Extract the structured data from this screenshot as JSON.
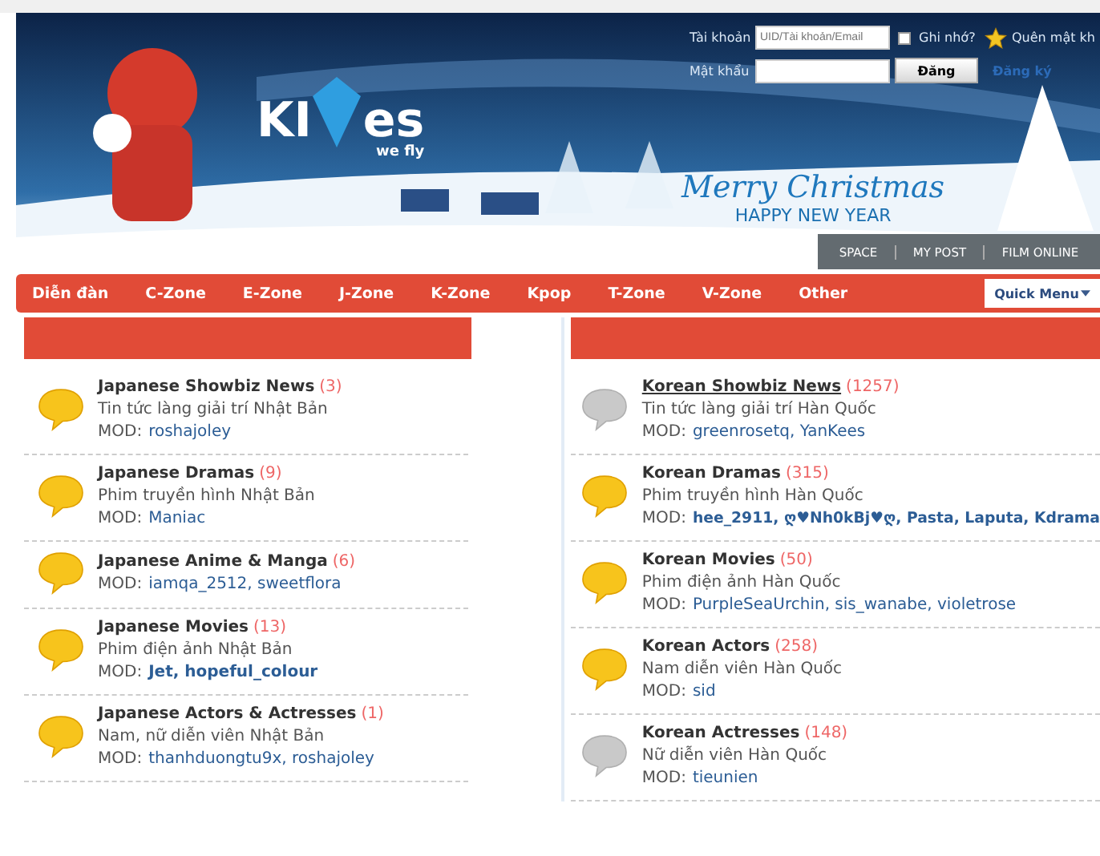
{
  "banner": {
    "logo_left": "KI",
    "logo_right": "es",
    "tagline": "we fly",
    "greeting": "Merry Christmas",
    "greeting_sub": "HAPPY NEW YEAR"
  },
  "login": {
    "account_label": "Tài khoản",
    "account_placeholder": "UID/Tài khoản/Email",
    "remember_label": "Ghi nhớ?",
    "remember_checked": false,
    "forgot_link": "Quên mật kh",
    "password_label": "Mật khẩu",
    "submit": "Đăng",
    "register_link": "Đăng ký"
  },
  "sub_tabs": [
    "SPACE",
    "MY POST",
    "FILM ONLINE"
  ],
  "nav": {
    "items": [
      "Diễn đàn",
      "C-Zone",
      "E-Zone",
      "J-Zone",
      "K-Zone",
      "Kpop",
      "T-Zone",
      "V-Zone",
      "Other"
    ],
    "quick_menu": "Quick Menu"
  },
  "columns": [
    {
      "forums": [
        {
          "title": "Japanese Showbiz News",
          "count": "(3)",
          "description": "Tin tức làng giải trí Nhật Bản",
          "mod_label": "MOD:",
          "mods": "roshajoley",
          "mods_bold": false,
          "has_new": true,
          "hovered": false
        },
        {
          "title": "Japanese Dramas",
          "count": "(9)",
          "description": "Phim truyền hình Nhật Bản",
          "mod_label": "MOD:",
          "mods": "Maniac",
          "mods_bold": false,
          "has_new": true,
          "hovered": false
        },
        {
          "title": "Japanese Anime & Manga",
          "count": "(6)",
          "mod_label": "MOD:",
          "mods": "iamqa_2512, sweetflora",
          "mods_bold": false,
          "has_new": true,
          "hovered": false
        },
        {
          "title": "Japanese Movies",
          "count": "(13)",
          "description": "Phim điện ảnh Nhật Bản",
          "mod_label": "MOD:",
          "mods": "Jet, hopeful_colour",
          "mods_bold": true,
          "has_new": true,
          "hovered": false
        },
        {
          "title": "Japanese Actors & Actresses",
          "count": "(1)",
          "description": "Nam, nữ diễn viên Nhật Bản",
          "mod_label": "MOD:",
          "mods": "thanhduongtu9x, roshajoley",
          "mods_bold": false,
          "has_new": true,
          "hovered": false
        }
      ]
    },
    {
      "forums": [
        {
          "title": "Korean Showbiz News",
          "count": "(1257)",
          "description": "Tin tức làng giải trí Hàn Quốc",
          "mod_label": "MOD:",
          "mods": "greenrosetq, YanKees",
          "mods_bold": false,
          "has_new": false,
          "hovered": true
        },
        {
          "title": "Korean Dramas",
          "count": "(315)",
          "description": "Phim truyền hình Hàn Quốc",
          "mod_label": "MOD:",
          "mods": "hee_2911, ღ♥Nh0kBj♥ღ, Pasta, Laputa, Kdrama",
          "mods_bold": true,
          "has_new": true,
          "hovered": false
        },
        {
          "title": "Korean Movies",
          "count": "(50)",
          "description": "Phim điện ảnh Hàn Quốc",
          "mod_label": "MOD:",
          "mods": "PurpleSeaUrchin, sis_wanabe, violetrose",
          "mods_bold": false,
          "has_new": true,
          "hovered": false
        },
        {
          "title": "Korean Actors",
          "count": "(258)",
          "description": "Nam diễn viên Hàn Quốc",
          "mod_label": "MOD:",
          "mods": "sid",
          "mods_bold": false,
          "has_new": true,
          "hovered": false
        },
        {
          "title": "Korean Actresses",
          "count": "(148)",
          "description": "Nữ diễn viên Hàn Quốc",
          "mod_label": "MOD:",
          "mods": "tieunien",
          "mods_bold": false,
          "has_new": false,
          "hovered": false
        }
      ]
    }
  ]
}
